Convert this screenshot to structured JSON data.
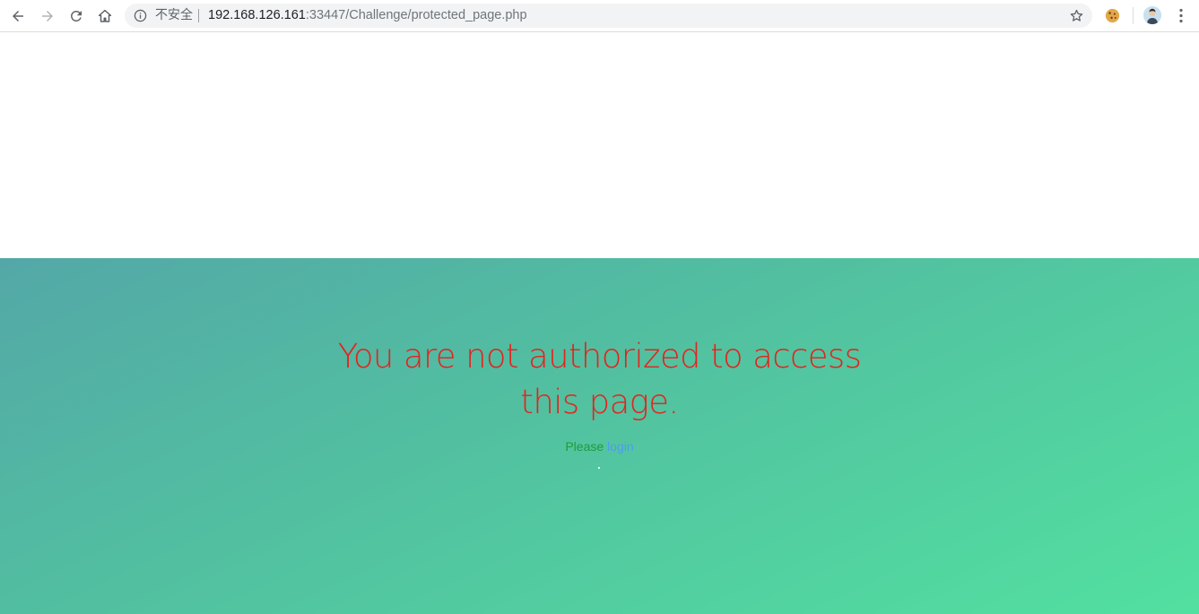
{
  "browser": {
    "security_label": "不安全",
    "url_host": "192.168.126.161",
    "url_rest": ":33447/Challenge/protected_page.php",
    "icons": {
      "back": "back-arrow-icon",
      "forward": "forward-arrow-icon",
      "reload": "reload-icon",
      "home": "home-icon",
      "info": "info-icon",
      "bookmark": "star-icon",
      "extension": "cookie-icon",
      "profile": "avatar",
      "menu": "kebab-menu-icon"
    }
  },
  "page": {
    "title": "You are not authorized to access this page.",
    "please_text": "Please",
    "login_link": "login",
    "colors": {
      "title": "#e3231e",
      "please": "#1f9b3a",
      "login": "#4d9ee8",
      "gradient_start": "#53a8a7",
      "gradient_end": "#52e0a0"
    }
  }
}
